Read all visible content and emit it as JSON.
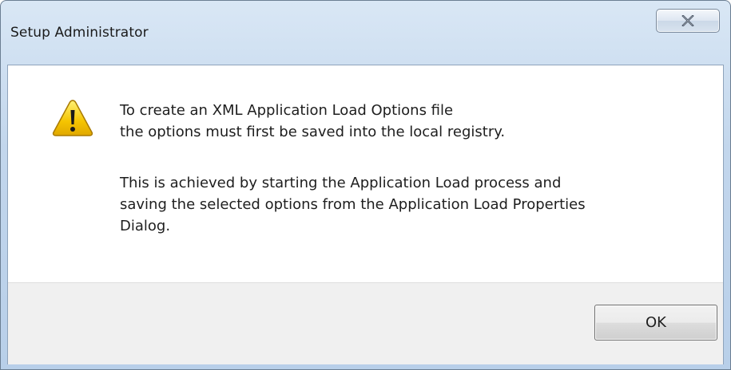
{
  "window": {
    "title": "Setup Administrator",
    "close_icon": "close-icon"
  },
  "message": {
    "icon": "warning-icon",
    "paragraph1": "To create an XML Application Load Options file\nthe options must first be saved into the local registry.",
    "paragraph2": "This is achieved by starting the Application Load process and\nsaving the selected options from the Application Load Properties\nDialog."
  },
  "buttons": {
    "ok_label": "OK"
  },
  "colors": {
    "titlebar": "#c2d6ec",
    "footer": "#f0f0f0",
    "warning_fill": "#f5c400"
  }
}
